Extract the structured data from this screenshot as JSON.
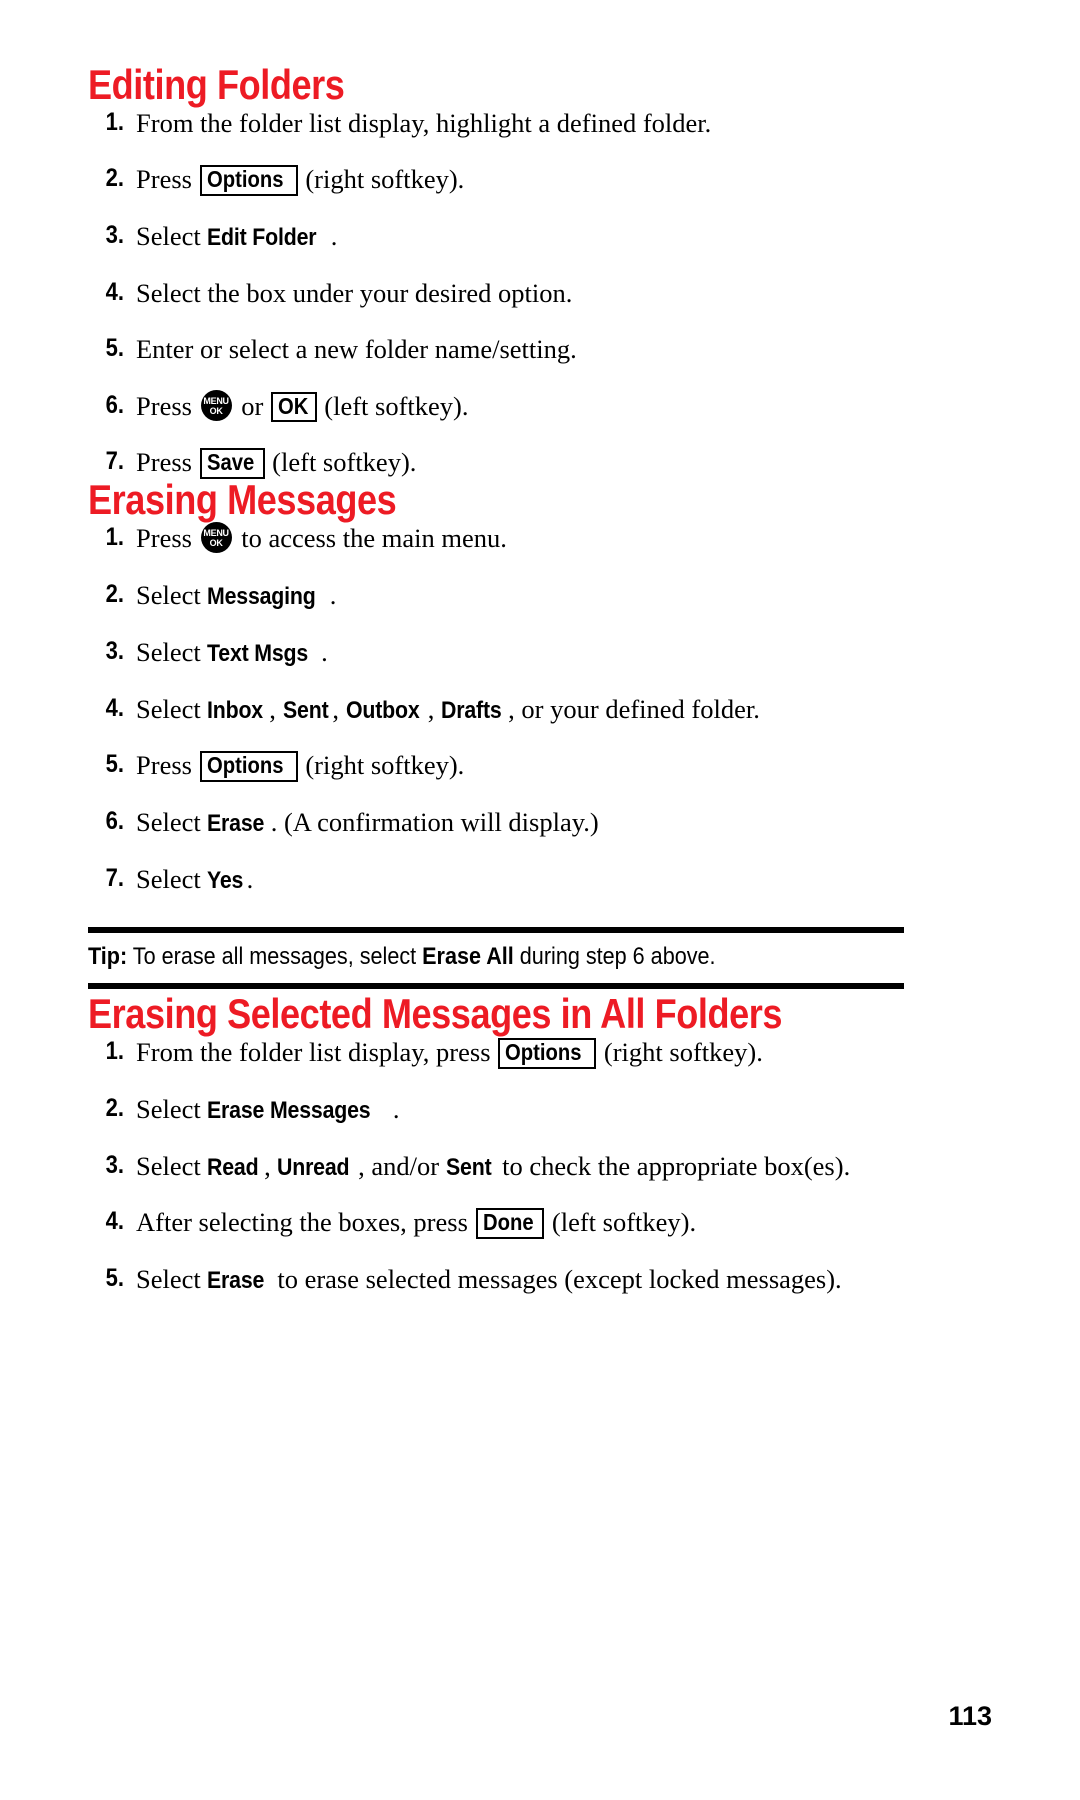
{
  "page": {
    "number": "113",
    "accent_color": "#ED1B24",
    "text_color": "#000000",
    "background": "#FFFFFF"
  },
  "sections": [
    {
      "heading": "Editing Folders",
      "steps": [
        {
          "num": "1.",
          "parts": [
            {
              "t": "text",
              "v": "From the folder list display, highlight a defined folder."
            }
          ]
        },
        {
          "num": "2.",
          "parts": [
            {
              "t": "text",
              "v": "Press "
            },
            {
              "t": "softkey",
              "v": "Options"
            },
            {
              "t": "text",
              "v": " (right softkey)."
            }
          ]
        },
        {
          "num": "3.",
          "parts": [
            {
              "t": "text",
              "v": "Select "
            },
            {
              "t": "ui",
              "v": "Edit Folder"
            },
            {
              "t": "text",
              "v": "."
            }
          ]
        },
        {
          "num": "4.",
          "parts": [
            {
              "t": "text",
              "v": "Select the box under your desired option."
            }
          ]
        },
        {
          "num": "5.",
          "parts": [
            {
              "t": "text",
              "v": "Enter or select a new folder name/setting."
            }
          ]
        },
        {
          "num": "6.",
          "parts": [
            {
              "t": "text",
              "v": "Press "
            },
            {
              "t": "menukey",
              "v": "MENU OK"
            },
            {
              "t": "text",
              "v": " or "
            },
            {
              "t": "softkey",
              "v": "OK"
            },
            {
              "t": "text",
              "v": " (left softkey)."
            }
          ]
        },
        {
          "num": "7.",
          "parts": [
            {
              "t": "text",
              "v": "Press "
            },
            {
              "t": "softkey",
              "v": "Save"
            },
            {
              "t": "text",
              "v": " (left softkey)."
            }
          ]
        }
      ]
    },
    {
      "heading": "Erasing Messages",
      "steps": [
        {
          "num": "1.",
          "parts": [
            {
              "t": "text",
              "v": "Press "
            },
            {
              "t": "menukey",
              "v": "MENU OK"
            },
            {
              "t": "text",
              "v": " to access the main menu."
            }
          ]
        },
        {
          "num": "2.",
          "parts": [
            {
              "t": "text",
              "v": "Select "
            },
            {
              "t": "ui",
              "v": "Messaging"
            },
            {
              "t": "text",
              "v": "."
            }
          ]
        },
        {
          "num": "3.",
          "parts": [
            {
              "t": "text",
              "v": "Select "
            },
            {
              "t": "ui",
              "v": "Text Msgs"
            },
            {
              "t": "text",
              "v": "."
            }
          ]
        },
        {
          "num": "4.",
          "parts": [
            {
              "t": "text",
              "v": "Select "
            },
            {
              "t": "ui",
              "v": "Inbox"
            },
            {
              "t": "text",
              "v": ", "
            },
            {
              "t": "ui",
              "v": "Sent"
            },
            {
              "t": "text",
              "v": ", "
            },
            {
              "t": "ui",
              "v": "Outbox"
            },
            {
              "t": "text",
              "v": ", "
            },
            {
              "t": "ui",
              "v": "Drafts"
            },
            {
              "t": "text",
              "v": ", or your defined folder."
            }
          ]
        },
        {
          "num": "5.",
          "parts": [
            {
              "t": "text",
              "v": "Press "
            },
            {
              "t": "softkey",
              "v": "Options"
            },
            {
              "t": "text",
              "v": " (right softkey)."
            }
          ]
        },
        {
          "num": "6.",
          "parts": [
            {
              "t": "text",
              "v": "Select "
            },
            {
              "t": "ui",
              "v": "Erase"
            },
            {
              "t": "text",
              "v": ". (A confirmation will display.)"
            }
          ]
        },
        {
          "num": "7.",
          "parts": [
            {
              "t": "text",
              "v": "Select "
            },
            {
              "t": "ui",
              "v": "Yes"
            },
            {
              "t": "text",
              "v": "."
            }
          ]
        }
      ],
      "tip": {
        "label": "Tip:",
        "parts": [
          {
            "t": "text",
            "v": " To erase all messages, select "
          },
          {
            "t": "strong",
            "v": "Erase All"
          },
          {
            "t": "text",
            "v": " during step 6 above."
          }
        ]
      }
    },
    {
      "heading": "Erasing Selected Messages in All Folders",
      "steps": [
        {
          "num": "1.",
          "parts": [
            {
              "t": "text",
              "v": "From the folder list display, press "
            },
            {
              "t": "softkey",
              "v": "Options"
            },
            {
              "t": "text",
              "v": " (right softkey)."
            }
          ]
        },
        {
          "num": "2.",
          "parts": [
            {
              "t": "text",
              "v": "Select "
            },
            {
              "t": "ui",
              "v": "Erase Messages"
            },
            {
              "t": "text",
              "v": "."
            }
          ]
        },
        {
          "num": "3.",
          "parts": [
            {
              "t": "text",
              "v": "Select "
            },
            {
              "t": "ui",
              "v": "Read"
            },
            {
              "t": "text",
              "v": ", "
            },
            {
              "t": "ui",
              "v": "Unread"
            },
            {
              "t": "text",
              "v": ", and/or "
            },
            {
              "t": "ui",
              "v": "Sent"
            },
            {
              "t": "text",
              "v": " to check the appropriate box(es)."
            }
          ]
        },
        {
          "num": "4.",
          "parts": [
            {
              "t": "text",
              "v": "After selecting the boxes, press "
            },
            {
              "t": "softkey",
              "v": "Done"
            },
            {
              "t": "text",
              "v": " (left softkey)."
            }
          ]
        },
        {
          "num": "5.",
          "parts": [
            {
              "t": "text",
              "v": "Select "
            },
            {
              "t": "ui",
              "v": "Erase"
            },
            {
              "t": "text",
              "v": " to erase selected messages (except locked messages)."
            }
          ]
        }
      ]
    }
  ],
  "icons": {
    "menu_ok_key": {
      "line1": "MENU",
      "line2": "OK"
    }
  }
}
